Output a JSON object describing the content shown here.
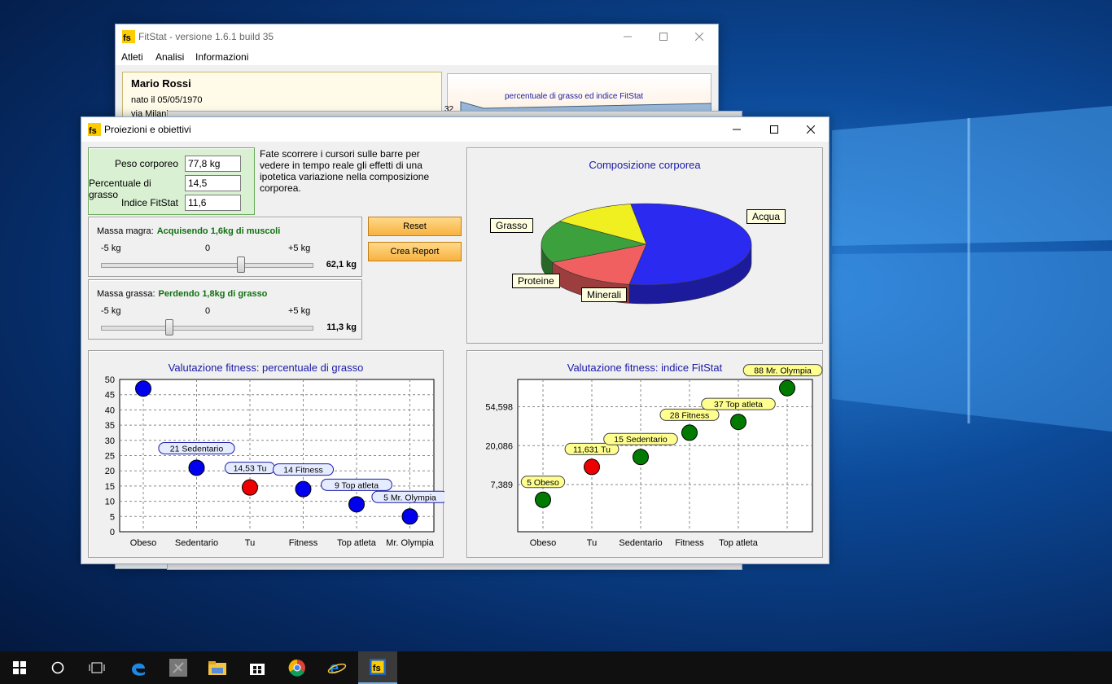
{
  "main_window": {
    "title": "FitStat - versione 1.6.1 build 35",
    "menu": [
      "Atleti",
      "Analisi",
      "Informazioni"
    ],
    "athlete": {
      "name": "Mario Rossi",
      "born": "nato il 05/05/1970",
      "address": "via Milani"
    },
    "back_chart_title": "percentuale di grasso ed indice FitStat",
    "back_chart_tick": "32"
  },
  "dialog": {
    "title": "Proiezioni e obiettivi",
    "stats": [
      {
        "label": "Peso corporeo",
        "value": "77,8 kg"
      },
      {
        "label": "Percentuale di grasso",
        "value": "14,5"
      },
      {
        "label": "Indice FitStat",
        "value": "11,6"
      }
    ],
    "hint": "Fate scorrere i cursori sulle barre per vedere in tempo reale gli effetti di una ipotetica variazione nella composizione corporea.",
    "sliders": [
      {
        "title": "Massa magra:",
        "status": "Acquisendo 1,6kg di muscoli",
        "min": "-5 kg",
        "mid": "0",
        "max": "+5 kg",
        "value": "62,1 kg",
        "position": 0.66
      },
      {
        "title": "Massa grassa:",
        "status": "Perdendo 1,8kg di grasso",
        "min": "-5 kg",
        "mid": "0",
        "max": "+5 kg",
        "value": "11,3 kg",
        "position": 0.32
      }
    ],
    "buttons": {
      "reset": "Reset",
      "report": "Crea Report"
    }
  },
  "colors": {
    "accent": "#1a1aa8",
    "status_green": "#107010",
    "button_orange": "#f7b240",
    "blue_dot": "#0000ee",
    "red_dot": "#ee0000",
    "green_dot": "#007a00"
  },
  "chart_data": [
    {
      "type": "pie",
      "title": "Composizione corporea",
      "categories": [
        "Acqua",
        "Grasso",
        "Proteine",
        "Minerali"
      ],
      "values": [
        55,
        15,
        17,
        13
      ],
      "colors": [
        "#2a2af0",
        "#f06060",
        "#3ca03c",
        "#f0f020"
      ]
    },
    {
      "type": "scatter",
      "title": "Valutazione fitness: percentuale di grasso",
      "categories": [
        "Obeso",
        "Sedentario",
        "Tu",
        "Fitness",
        "Top atleta",
        "Mr. Olympia"
      ],
      "values": [
        47,
        21,
        14.53,
        14,
        9,
        5
      ],
      "labels": [
        "",
        "21 Sedentario",
        "14,53 Tu",
        "14 Fitness",
        "9 Top atleta",
        "5 Mr. Olympia"
      ],
      "highlight": "Tu",
      "ylim": [
        0,
        50
      ],
      "yticks": [
        "0",
        "5",
        "10",
        "15",
        "20",
        "25",
        "30",
        "35",
        "40",
        "45",
        "50"
      ]
    },
    {
      "type": "scatter",
      "title": "Valutazione fitness: indice FitStat",
      "categories": [
        "Obeso",
        "Tu",
        "Sedentario",
        "Fitness",
        "Top atleta",
        "Mr. Olympia"
      ],
      "xticks": [
        "Obeso",
        "Tu",
        "Sedentario",
        "Fitness",
        "Top atleta"
      ],
      "values": [
        5,
        11.631,
        15,
        28,
        37,
        88
      ],
      "labels": [
        "5 Obeso",
        "11,631 Tu",
        "15 Sedentario",
        "28 Fitness",
        "37 Top atleta",
        "88 Mr. Olympia"
      ],
      "highlight": "Tu",
      "y_scale": "log",
      "ylim": [
        2.2,
        110
      ],
      "ytick_values": [
        7.389,
        20.086,
        54.598
      ],
      "yticks": [
        "7,389",
        "20,086",
        "54,598"
      ]
    }
  ]
}
